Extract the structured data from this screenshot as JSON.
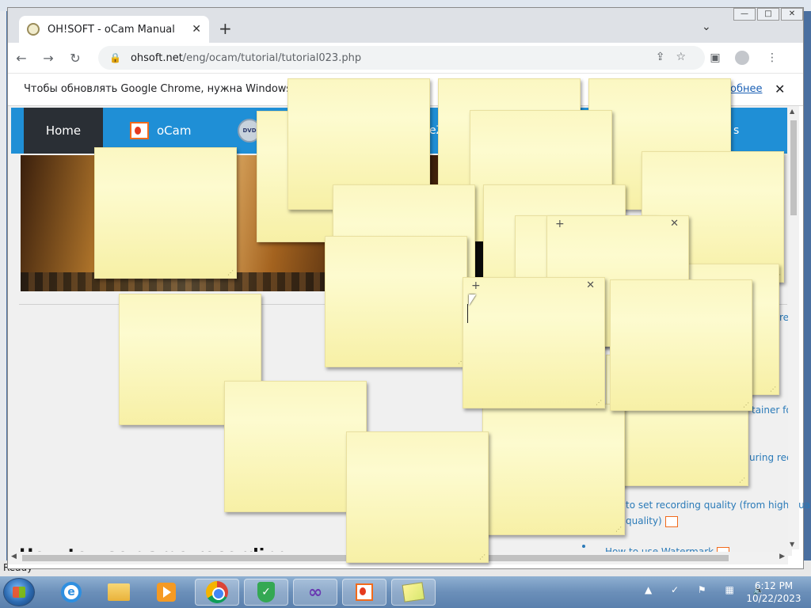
{
  "background_window": {
    "title": "",
    "status": "Ready"
  },
  "browser": {
    "tab_title": "OH!SOFT - oCam Manual",
    "tab_close": "✕",
    "new_tab": "+",
    "tab_search": "⌄",
    "window_buttons": [
      "—",
      "□",
      "✕"
    ],
    "url_host": "ohsoft.net",
    "url_path": "/eng/ocam/tutorial/tutorial023.php",
    "back": "←",
    "forward": "→",
    "reload": "↻",
    "lock": "🔒",
    "share": "⇪",
    "bookmark": "☆",
    "sidepanel": "▣",
    "menu": "⋮"
  },
  "infobar": {
    "message": "Чтобы обновлять Google Chrome, нужна Windows 10 ил",
    "link_fragment": "обнее",
    "close": "✕"
  },
  "site": {
    "nav_home": "Home",
    "nav_ocam": "oCam",
    "dvd_label": "DVD",
    "nav_frag1": "eZ",
    "nav_frag2": "s",
    "heading": "How to use game recording",
    "link_re": "re",
    "link_container": "tainer fo",
    "link_during": "uring rec",
    "link_quality1": "to set recording quality (from high-qua",
    "link_quality2": "quality)",
    "link_watermark": "How to use Watermark"
  },
  "taskbar": {
    "ie_glyph": "e",
    "shield_glyph": "✓",
    "vs_glyph": "∞",
    "tray_icons": "▲ ✓ ⚑ ▦ 🔈",
    "time": "6:12 PM",
    "date": "10/22/2023"
  }
}
